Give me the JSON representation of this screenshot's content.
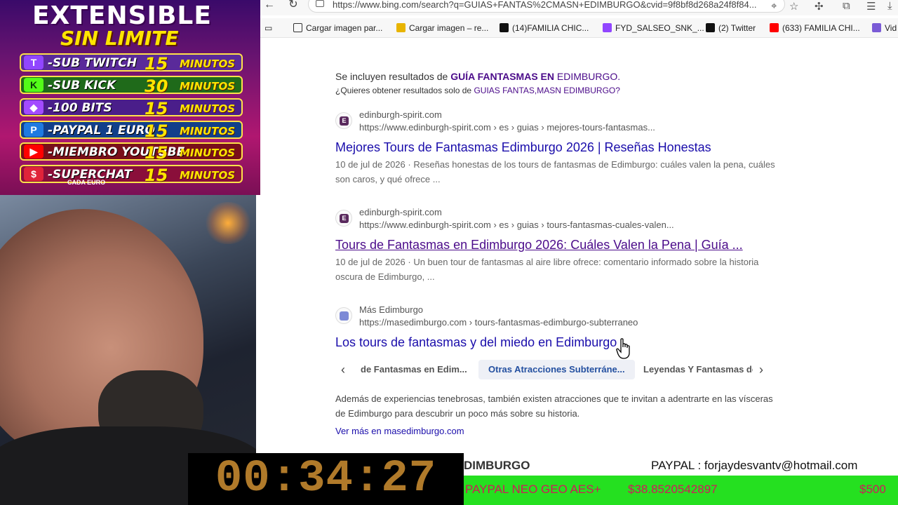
{
  "browser": {
    "url": "https://www.bing.com/search?q=GUIAS+FANTAS%2CMASN+EDIMBURGO&cvid=9f8bf8d268a24f8f84...",
    "icons": [
      "back-icon",
      "reload-icon",
      "location-icon",
      "star-icon",
      "extensions-icon",
      "split-icon",
      "more-icon",
      "download-icon"
    ],
    "bookmarks": [
      {
        "label": "Cargar imagen par...",
        "icon": "image-icon",
        "color": "#333333"
      },
      {
        "label": "Cargar imagen – re...",
        "icon": "image-icon",
        "color": "#e8b400"
      },
      {
        "label": "(14)FAMILIA CHIC...",
        "icon": "tiktok-icon",
        "color": "#111111"
      },
      {
        "label": "FYD_SALSEO_SNK_...",
        "icon": "twitch-icon",
        "color": "#9146ff"
      },
      {
        "label": "(2) Twitter",
        "icon": "x-icon",
        "color": "#111111"
      },
      {
        "label": "(633) FAMILIA CHI...",
        "icon": "youtube-icon",
        "color": "#ff0000"
      },
      {
        "label": "Vid",
        "icon": "sl-icon",
        "color": "#7a5bd6"
      }
    ]
  },
  "search": {
    "included_prefix": "Se incluyen resultados de ",
    "included_bold": "GUÍA FANTASMAS EN",
    "included_rest": " EDIMBURGO.",
    "only_prefix": "¿Quieres obtener resultados solo de ",
    "only_link": "GUIAS FANTAS,MASN EDIMBURGO?",
    "results": [
      {
        "favicon": "E",
        "site": "edinburgh-spirit.com",
        "crumb": "https://www.edinburgh-spirit.com › es › guias › mejores-tours-fantasmas...",
        "title": "Mejores Tours de Fantasmas Edimburgo 2026 | Reseñas Honestas",
        "date": "10 de jul de 2026",
        "snippet": " · Reseñas honestas de los tours de fantasmas de Edimburgo: cuáles valen la pena, cuáles son caros, y qué ofrece ..."
      },
      {
        "favicon": "E",
        "site": "edinburgh-spirit.com",
        "crumb": "https://www.edinburgh-spirit.com › es › guias › tours-fantasmas-cuales-valen...",
        "title": "Tours de Fantasmas en Edimburgo 2026: Cuáles Valen la Pena | Guía ...",
        "date": "10 de jul de 2026",
        "snippet": " · Un buen tour de fantasmas al aire libre ofrece: comentario informado sobre la historia oscura de Edimburgo, ..."
      },
      {
        "favicon": "",
        "site": "Más Edimburgo",
        "crumb": "https://masedimburgo.com › tours-fantasmas-edimburgo-subterraneo",
        "title": "Los tours de fantasmas y del miedo en Edimburgo"
      }
    ],
    "carousel": [
      "de Fantasmas en Edim...",
      "Otras Atracciones Subterráne...",
      "Leyendas Y Fantasmas de"
    ],
    "extra_text": "Además de experiencias tenebrosas, también existen atracciones que te invitan a adentrarte en las vísceras de Edimburgo para descubrir un poco más sobre su historia.",
    "more_link": "Ver más en masedimburgo.com",
    "partial_heading": "DIMBURGO"
  },
  "stream": {
    "headline_1": "EXTENSIBLE",
    "headline_2": "SIN LIMITE",
    "perks": [
      {
        "icon": "twitch-icon",
        "icon_text": "T",
        "label": "-SUB TWITCH",
        "amount": "15",
        "unit": "MINUTOS",
        "color": "#9146ff"
      },
      {
        "icon": "kick-icon",
        "icon_text": "K",
        "label": "-SUB KICK",
        "amount": "30",
        "unit": "MINUTOS",
        "color": "#53fc18"
      },
      {
        "icon": "bits-icon",
        "icon_text": "◆",
        "label": "-100 BITS",
        "amount": "15",
        "unit": "MINUTOS",
        "color": "#a34bff"
      },
      {
        "icon": "paypal-icon",
        "icon_text": "P",
        "label": "-PAYPAL 1 EURO",
        "amount": "15",
        "unit": "MINUTOS",
        "color": "#1f7ae0"
      },
      {
        "icon": "youtube-icon",
        "icon_text": "▶",
        "label": "-MIEMBRO YOUTUBE",
        "amount": "15",
        "unit": "MINUTOS",
        "color": "#ff0000"
      },
      {
        "icon": "superchat-icon",
        "icon_text": "$",
        "label": "-SUPERCHAT",
        "amount": "15",
        "unit": "MINUTOS",
        "color": "#e0243a",
        "note": "CADA EURO"
      }
    ],
    "timer": "00:34:27",
    "paypal": "PAYPAL : forjaydesvantv@hotmail.com",
    "ticker": {
      "item_1": "PAYPAL NEO GEO AES+",
      "item_2": "$38.8520542897",
      "item_3": "$500"
    }
  }
}
